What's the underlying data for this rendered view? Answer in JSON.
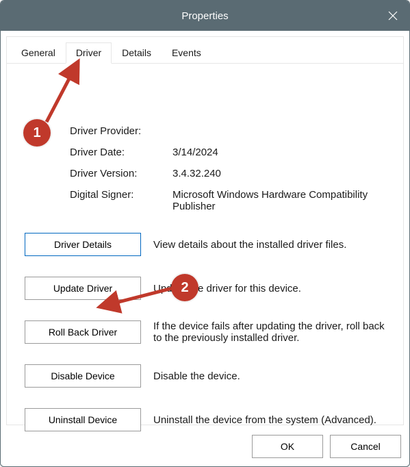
{
  "window": {
    "title": "Properties"
  },
  "tabs": {
    "t0": {
      "label": "General"
    },
    "t1": {
      "label": "Driver"
    },
    "t2": {
      "label": "Details"
    },
    "t3": {
      "label": "Events"
    },
    "active_index": 1
  },
  "driver_info": {
    "provider_label": "Driver Provider:",
    "provider_value": "",
    "date_label": "Driver Date:",
    "date_value": "3/14/2024",
    "version_label": "Driver Version:",
    "version_value": "3.4.32.240",
    "signer_label": "Digital Signer:",
    "signer_value": "Microsoft Windows Hardware Compatibility Publisher"
  },
  "actions": {
    "driver_details": {
      "label": "Driver Details",
      "desc": "View details about the installed driver files."
    },
    "update_driver": {
      "label": "Update Driver",
      "desc": "Update the driver for this device."
    },
    "roll_back": {
      "label": "Roll Back Driver",
      "desc": "If the device fails after updating the driver, roll back to the previously installed driver."
    },
    "disable_device": {
      "label": "Disable Device",
      "desc": "Disable the device."
    },
    "uninstall_device": {
      "label": "Uninstall Device",
      "desc": "Uninstall the device from the system (Advanced)."
    }
  },
  "footer": {
    "ok": "OK",
    "cancel": "Cancel"
  },
  "annotations": {
    "badge1": "1",
    "badge2": "2",
    "color": "#c0392b"
  }
}
